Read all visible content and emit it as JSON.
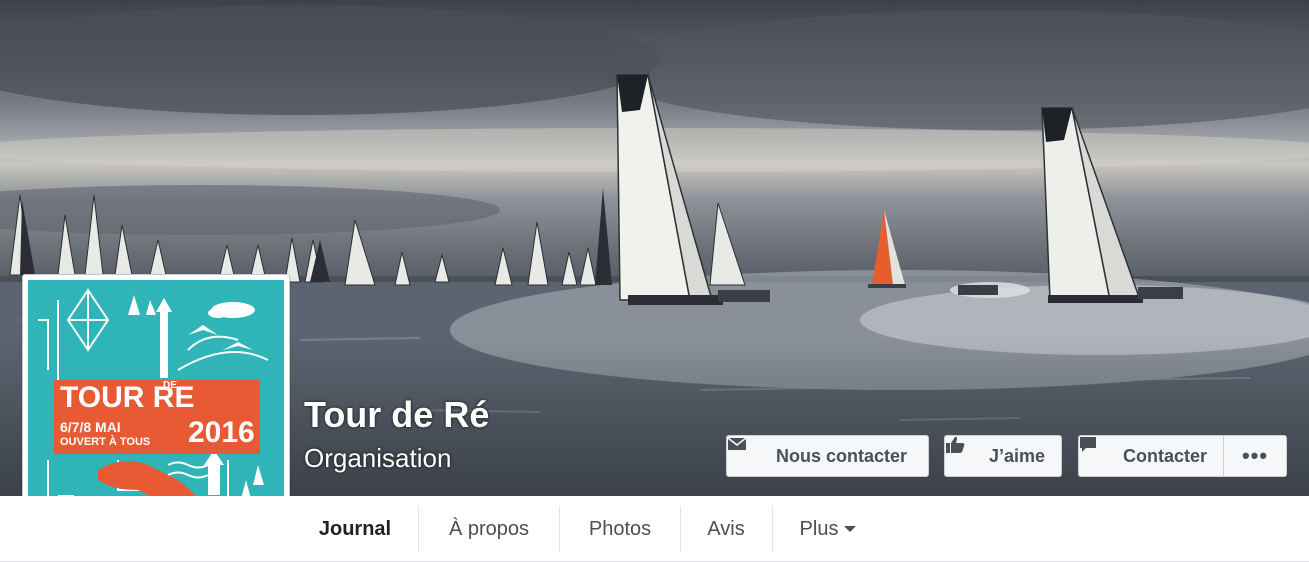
{
  "page": {
    "title": "Tour de Ré",
    "category": "Organisation"
  },
  "actions": {
    "contact_label": "Nous contacter",
    "like_label": "J’aime",
    "message_label": "Contacter",
    "more_label": "•••"
  },
  "profile_logo": {
    "title": "TOUR RE",
    "de": "DE",
    "dates": "6/7/8 MAI",
    "subtitle": "OUVERT À TOUS",
    "year": "2016"
  },
  "tabs": [
    {
      "label": "Journal",
      "active": true
    },
    {
      "label": "À propos",
      "active": false
    },
    {
      "label": "Photos",
      "active": false
    },
    {
      "label": "Avis",
      "active": false
    },
    {
      "label": "Plus",
      "active": false
    }
  ],
  "colors": {
    "logo_teal": "#2fb4b8",
    "logo_orange": "#e75a33",
    "button_bg": "#f6f7f9",
    "text_dark": "#1d2129"
  },
  "icons": {
    "contact": "envelope-icon",
    "like": "thumbs-up-icon",
    "message": "speech-bubble-icon",
    "more": "ellipsis-icon"
  }
}
